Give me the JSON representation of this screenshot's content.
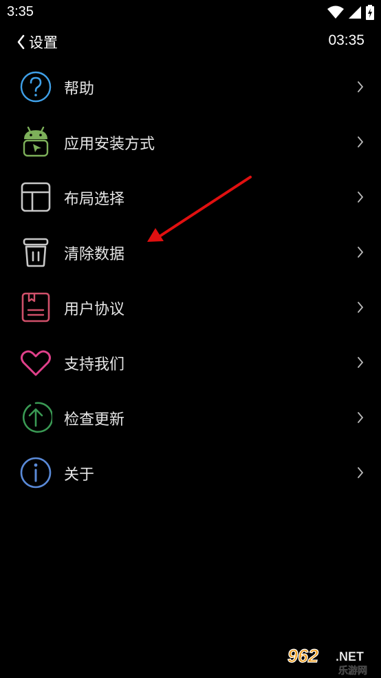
{
  "status_bar": {
    "time": "3:35",
    "wifi_icon": "wifi-icon",
    "signal_icon": "signal-icon",
    "battery_icon": "battery-charging-icon"
  },
  "header": {
    "back_icon": "chevron-left-icon",
    "title": "设置",
    "clock": "03:35"
  },
  "menu": {
    "items": [
      {
        "label": "帮助",
        "icon": "help-circle-icon",
        "color": "#3fa0e8"
      },
      {
        "label": "应用安装方式",
        "icon": "android-install-icon",
        "color": "#7db05a"
      },
      {
        "label": "布局选择",
        "icon": "layout-icon",
        "color": "#c8c8c8"
      },
      {
        "label": "清除数据",
        "icon": "trash-icon",
        "color": "#c8c8c8"
      },
      {
        "label": "用户协议",
        "icon": "document-icon",
        "color": "#d0506a"
      },
      {
        "label": "支持我们",
        "icon": "heart-icon",
        "color": "#e0408a"
      },
      {
        "label": "检查更新",
        "icon": "update-arrow-icon",
        "color": "#3a9a54"
      },
      {
        "label": "关于",
        "icon": "info-icon",
        "color": "#5a8ad8"
      }
    ]
  },
  "annotation": {
    "color": "#e01010"
  },
  "watermark": {
    "number": "962",
    "suffix": ".NET",
    "text": "乐游网"
  }
}
